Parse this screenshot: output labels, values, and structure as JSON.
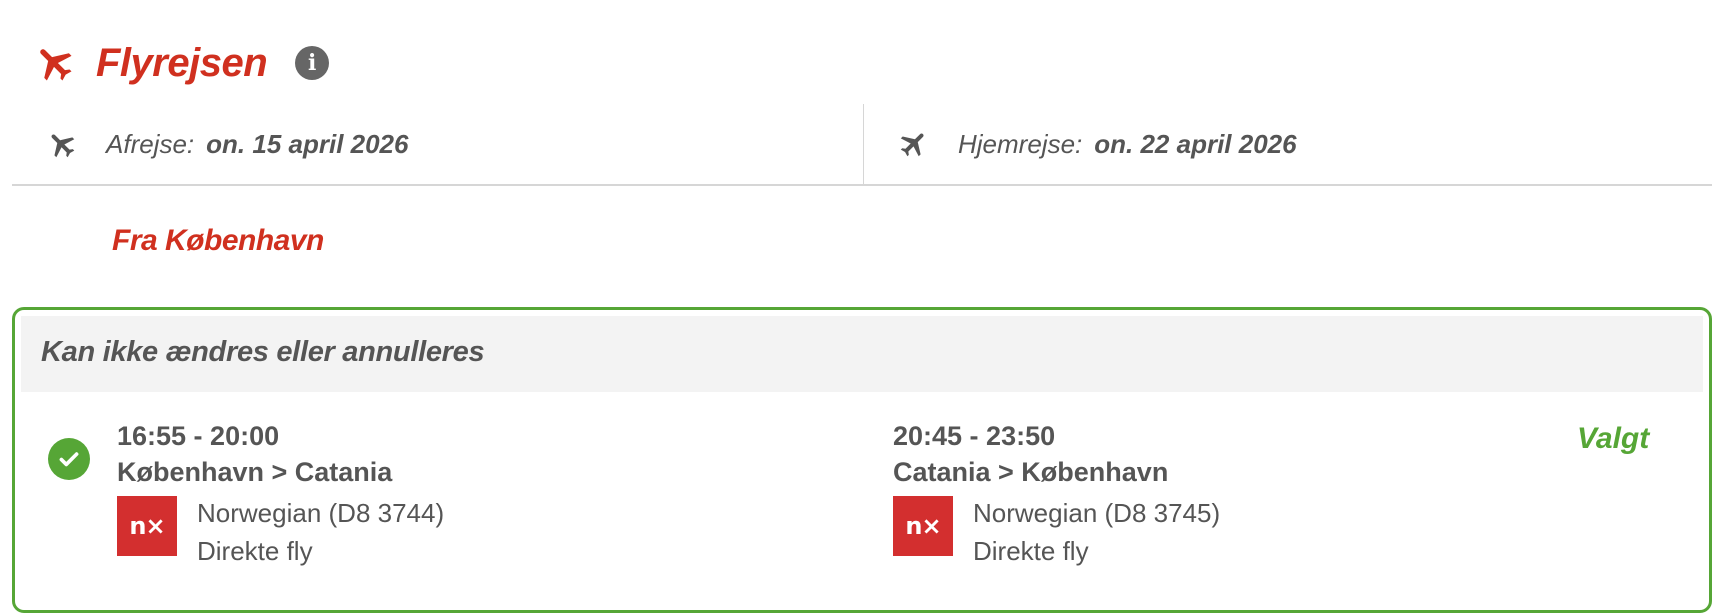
{
  "section": {
    "title": "Flyrejsen",
    "info_icon": "info-icon",
    "plane_icon": "airplane-icon"
  },
  "dates": {
    "outbound_label": "Afrejse:",
    "outbound_date": "on. 15 april 2026",
    "return_label": "Hjemrejse:",
    "return_date": "on. 22 april 2026"
  },
  "origin_heading": "Fra København",
  "option": {
    "header": "Kan ikke ændres eller annulleres",
    "status": "Valgt",
    "outbound": {
      "time": "16:55 - 20:00",
      "route": "København > Catania",
      "airline": "Norwegian (D8 3744)",
      "type": "Direkte fly",
      "logo_text": "n⨯"
    },
    "return": {
      "time": "20:45 - 23:50",
      "route": "Catania > København",
      "airline": "Norwegian (D8 3745)",
      "type": "Direkte fly",
      "logo_text": "n⨯"
    }
  },
  "colors": {
    "brand_red": "#d0301f",
    "selected_green": "#56a636",
    "text_gray": "#555555"
  }
}
